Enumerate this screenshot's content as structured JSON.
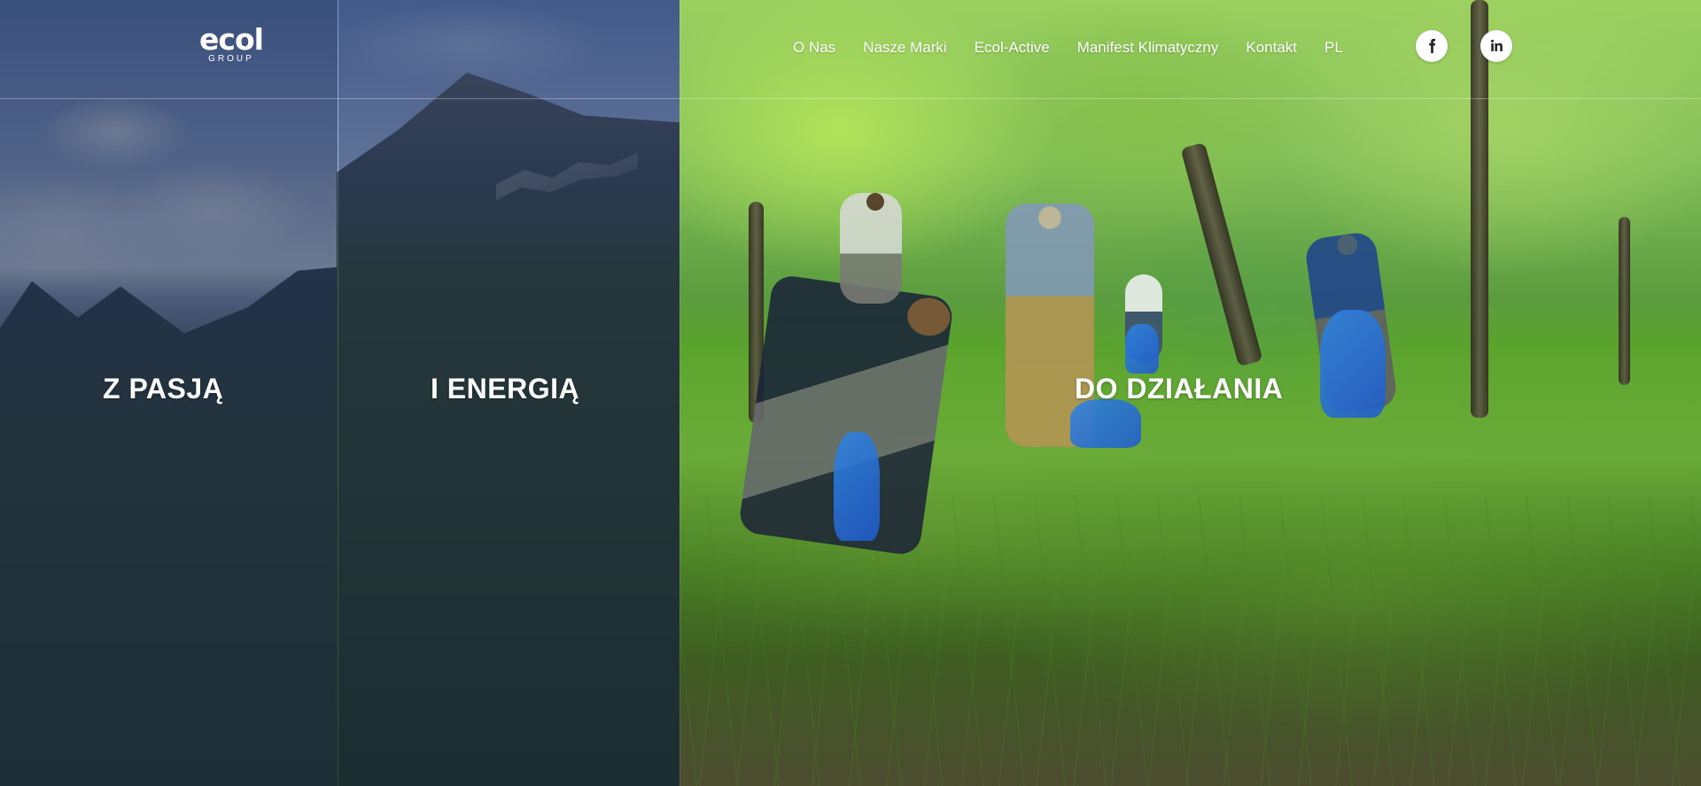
{
  "brand": {
    "logo_main": "ecol",
    "logo_sub": "GROUP"
  },
  "navigation": [
    {
      "label": "O Nas"
    },
    {
      "label": "Nasze Marki"
    },
    {
      "label": "Ecol-Active"
    },
    {
      "label": "Manifest Klimatyczny"
    },
    {
      "label": "Kontakt"
    },
    {
      "label": "PL"
    }
  ],
  "social": [
    {
      "icon": "facebook-icon"
    },
    {
      "icon": "linkedin-icon"
    }
  ],
  "hero": {
    "panels": [
      {
        "label": "Z PASJĄ"
      },
      {
        "label": "I ENERGIĄ"
      },
      {
        "label": "DO DZIAŁANIA"
      }
    ]
  },
  "colors": {
    "overlay": "#122148",
    "text": "#ffffff",
    "social_background": "#ffffff"
  }
}
